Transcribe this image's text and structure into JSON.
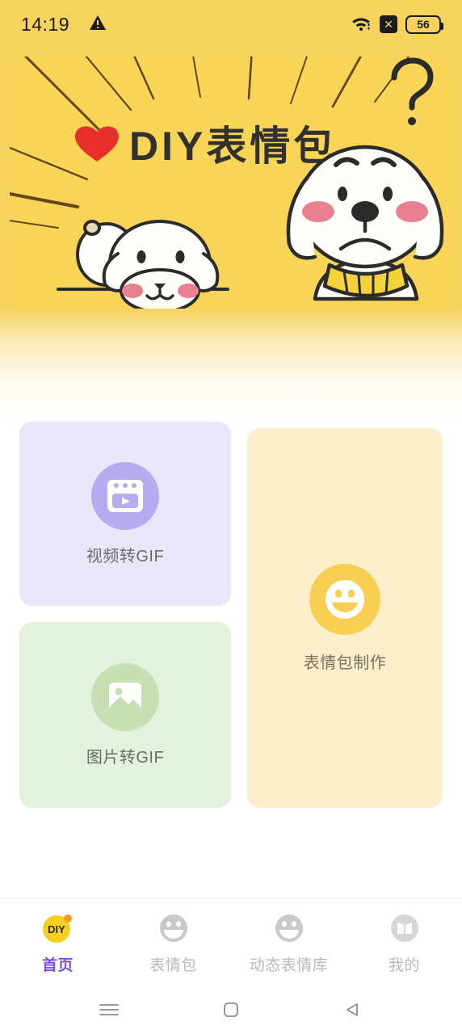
{
  "statusbar": {
    "time": "14:19",
    "warning_icon": "warning-triangle-icon",
    "wifi_icon": "wifi-icon",
    "no_signal_icon": "x-badge-icon",
    "battery_level": "56"
  },
  "banner": {
    "heart_icon": "heart-icon",
    "title": "DIY表情包",
    "question_mark": "?",
    "bg_color": "#f8d557",
    "accent_color": "#e03131",
    "mascot_left": "dog-mascot-lying",
    "mascot_right": "dog-mascot-scarf"
  },
  "features": [
    {
      "key": "video-to-gif",
      "label": "视频转GIF",
      "icon": "video-player-icon",
      "card_color": "#eae6fa",
      "icon_color": "#b6abee"
    },
    {
      "key": "image-to-gif",
      "label": "图片转GIF",
      "icon": "photo-image-icon",
      "card_color": "#e4f1dc",
      "icon_color": "#c6e0b4"
    },
    {
      "key": "sticker-maker",
      "label": "表情包制作",
      "icon": "smiley-face-icon",
      "card_color": "#fceecb",
      "icon_color": "#f7cf52"
    }
  ],
  "tabbar": {
    "active_color": "#7a4ef0",
    "inactive_color": "#b9b9b9",
    "items": [
      {
        "label": "首页",
        "icon": "diy-logo-icon",
        "active": true
      },
      {
        "label": "表情包",
        "icon": "smiley-face-icon",
        "active": false
      },
      {
        "label": "动态表情库",
        "icon": "smiley-face-icon",
        "active": false
      },
      {
        "label": "我的",
        "icon": "book-icon",
        "active": false
      }
    ]
  },
  "sysnav": {
    "recents": "menu-lines-icon",
    "home": "home-square-icon",
    "back": "back-triangle-icon"
  }
}
